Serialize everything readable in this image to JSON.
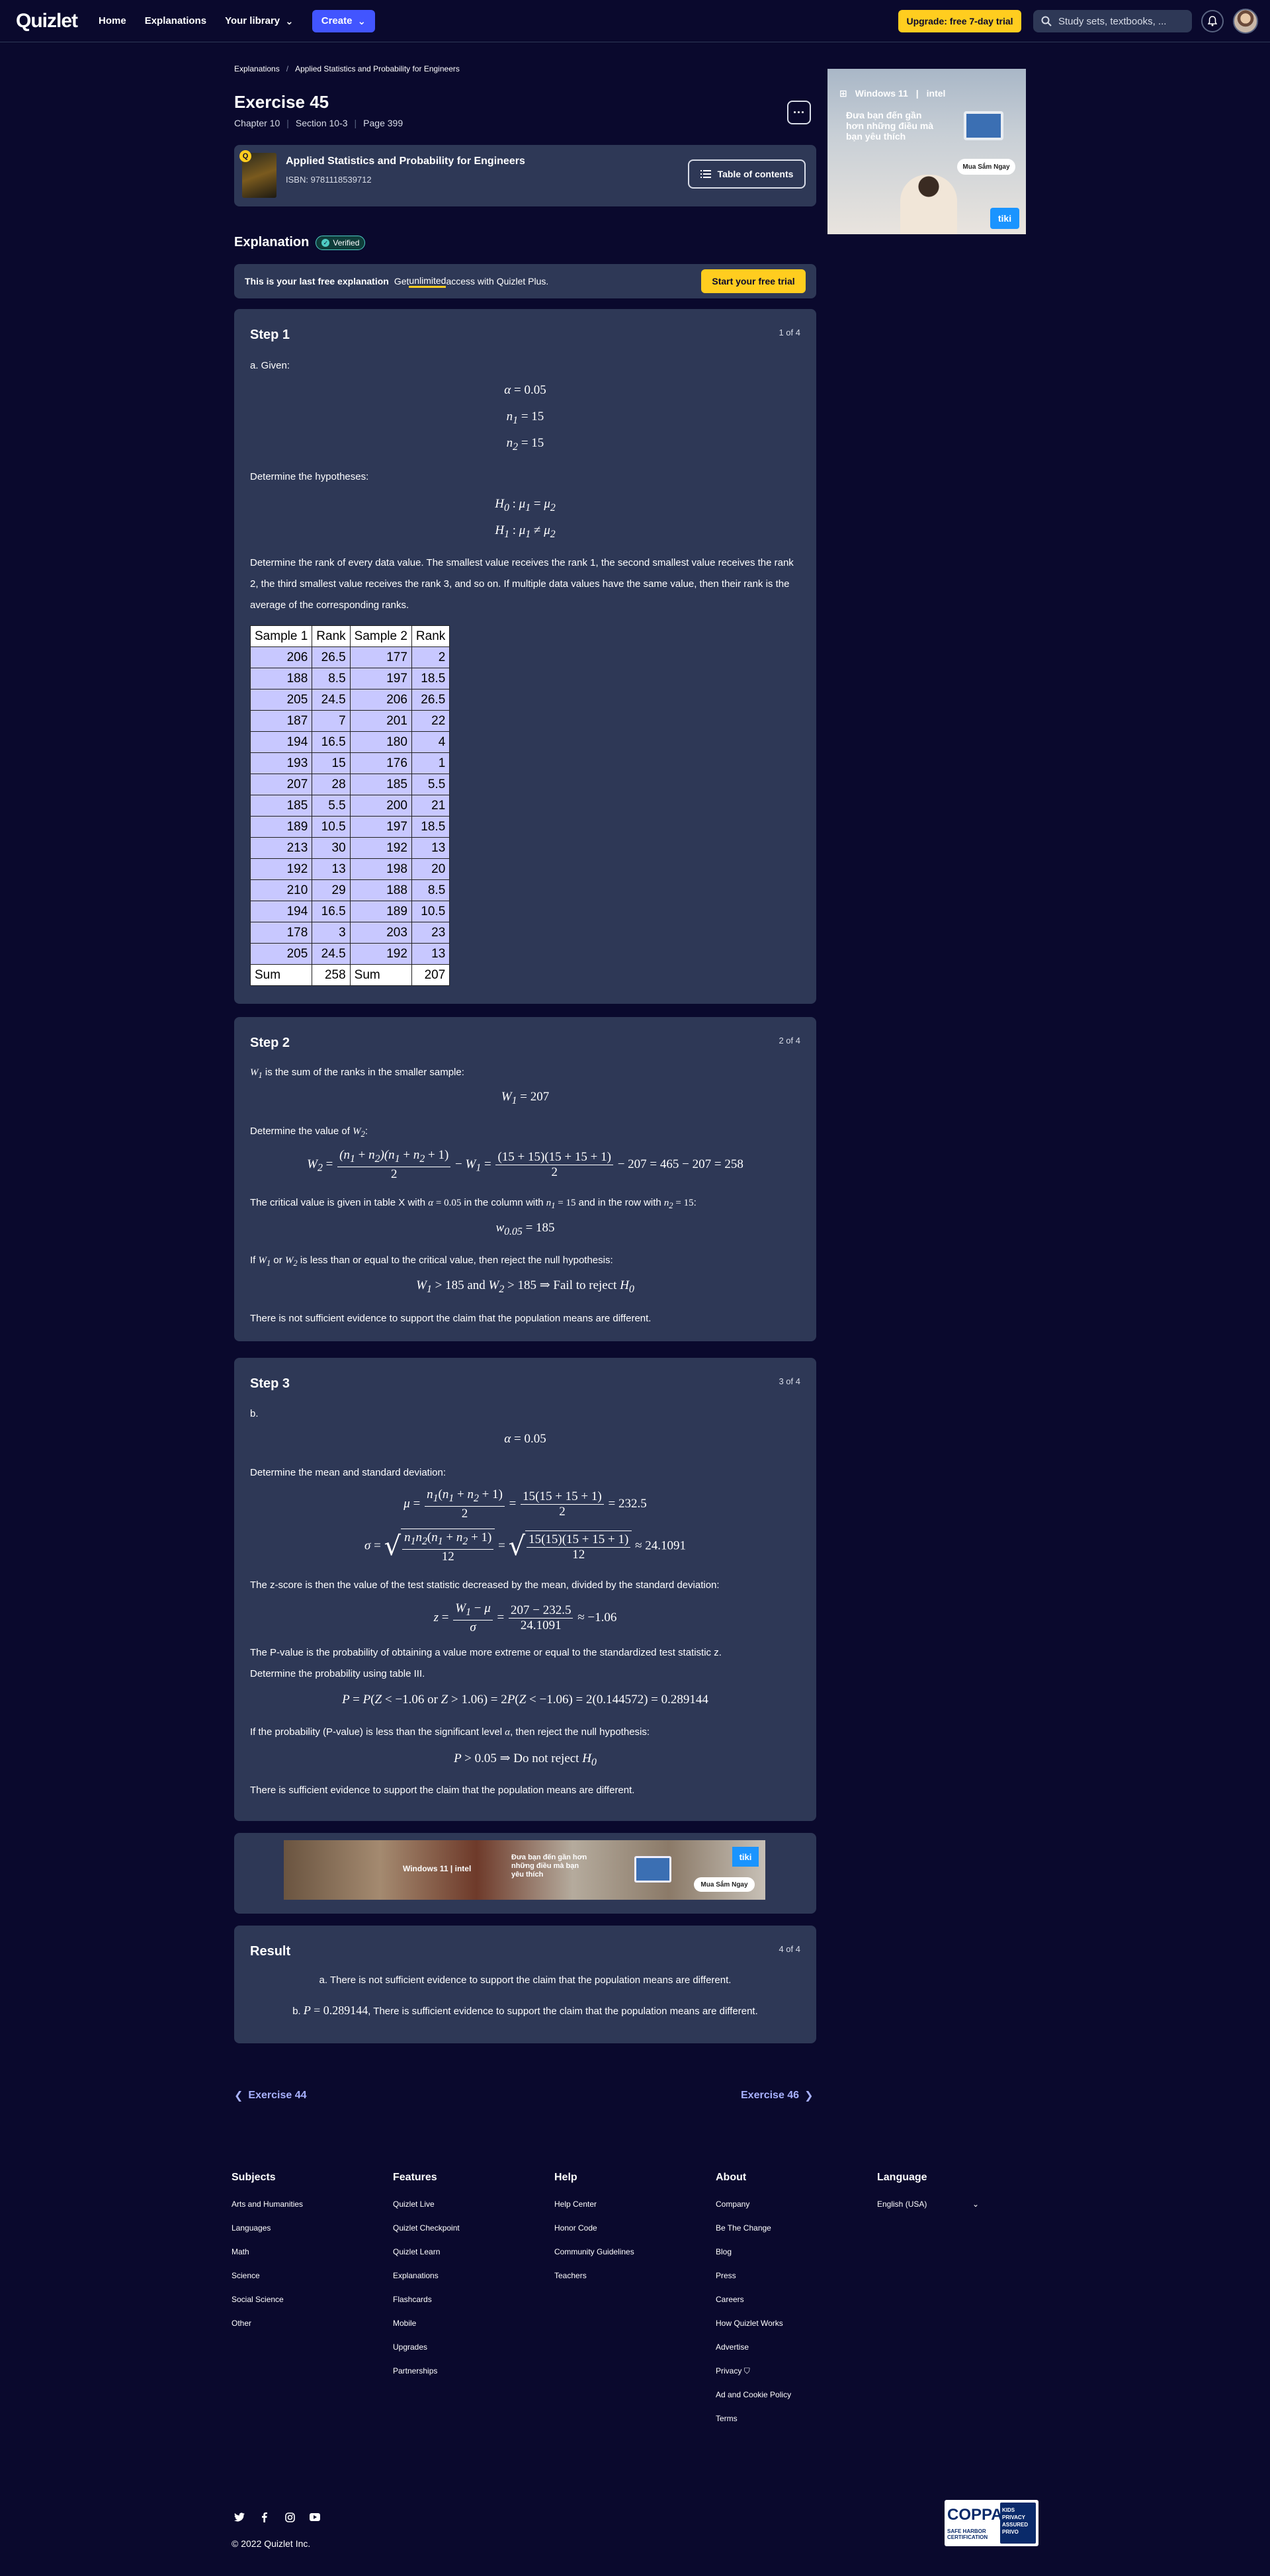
{
  "nav": {
    "logo": "Quizlet",
    "home": "Home",
    "explanations": "Explanations",
    "library": "Your library",
    "create": "Create",
    "upgrade": "Upgrade: free 7-day trial",
    "search_placeholder": "Study sets, textbooks, ..."
  },
  "breadcrumb": {
    "root": "Explanations",
    "current": "Applied Statistics and Probability for Engineers"
  },
  "exercise": {
    "title": "Exercise 45",
    "chapter": "Chapter 10",
    "section": "Section 10-3",
    "page": "Page 399",
    "more": "···"
  },
  "book": {
    "title": "Applied Statistics and Probability for Engineers",
    "isbn": "ISBN: 9781118539712",
    "toc": "Table of contents"
  },
  "ad_side": {
    "brand1": "Windows 11",
    "brand2": "intel",
    "text": "Đưa bạn đến gần hơn những điều mà bạn yêu thích",
    "cta": "Mua Sắm Ngay",
    "shop": "tiki"
  },
  "explanation": {
    "heading": "Explanation",
    "verified": "Verified"
  },
  "promo": {
    "bold": "This is your last free explanation",
    "text1": "Get ",
    "underline": "unlimited",
    "text2": " access with Quizlet Plus.",
    "cta": "Start your free trial"
  },
  "step1": {
    "title": "Step 1",
    "count": "1 of 4",
    "given": "a. Given:",
    "hyp_intro": "Determine the hypotheses:",
    "rank_text": "Determine the rank of every data value. The smallest value receives the rank 1, the second smallest value receives the rank 2, the third smallest value receives the rank 3, and so on. If multiple data values have the same value, then their rank is the average of the corresponding ranks.",
    "table": {
      "headers": [
        "Sample 1",
        "Rank",
        "Sample 2",
        "Rank"
      ],
      "rows": [
        [
          "206",
          "26.5",
          "177",
          "2"
        ],
        [
          "188",
          "8.5",
          "197",
          "18.5"
        ],
        [
          "205",
          "24.5",
          "206",
          "26.5"
        ],
        [
          "187",
          "7",
          "201",
          "22"
        ],
        [
          "194",
          "16.5",
          "180",
          "4"
        ],
        [
          "193",
          "15",
          "176",
          "1"
        ],
        [
          "207",
          "28",
          "185",
          "5.5"
        ],
        [
          "185",
          "5.5",
          "200",
          "21"
        ],
        [
          "189",
          "10.5",
          "197",
          "18.5"
        ],
        [
          "213",
          "30",
          "192",
          "13"
        ],
        [
          "192",
          "13",
          "198",
          "20"
        ],
        [
          "210",
          "29",
          "188",
          "8.5"
        ],
        [
          "194",
          "16.5",
          "189",
          "10.5"
        ],
        [
          "178",
          "3",
          "203",
          "23"
        ],
        [
          "205",
          "24.5",
          "192",
          "13"
        ]
      ],
      "sum": [
        "Sum",
        "258",
        "Sum",
        "207"
      ]
    }
  },
  "step2": {
    "title": "Step 2",
    "count": "2 of 4",
    "t1": " is the sum of the ranks in the smaller sample:",
    "t2": "Determine the value of ",
    "t3a": "The critical value is given in table X with ",
    "t3b": " in the column with ",
    "t3c": " and in the row with ",
    "t4a": "If ",
    "t4b": " or ",
    "t4c": " is less than or equal to the critical value, then reject the null hypothesis:",
    "t5": "There is not sufficient evidence to support the claim that the population means are different."
  },
  "step3": {
    "title": "Step 3",
    "count": "3 of 4",
    "b": "b.",
    "t1": "Determine the mean and standard deviation:",
    "t2": "The z-score is then the value of the test statistic decreased by the mean, divided by the standard deviation:",
    "t3": "The P-value is the probability of obtaining a value more extreme or equal to the standardized test statistic z.",
    "t4": "Determine the probability using table III.",
    "t5a": "If the probability (P-value) is less than the significant level ",
    "t5b": ", then reject the null hypothesis:",
    "t6": "There is sufficient evidence to support the claim that the population means are different."
  },
  "result": {
    "title": "Result",
    "count": "4 of 4",
    "a": "a. There is not sufficient evidence to support the claim that the population means are different.",
    "b_pre": "b. ",
    "b_post": " There is sufficient evidence to support the claim that the population means are different."
  },
  "pager": {
    "prev": "Exercise 44",
    "next": "Exercise 46"
  },
  "footer": {
    "subjects": {
      "h": "Subjects",
      "items": [
        "Arts and Humanities",
        "Languages",
        "Math",
        "Science",
        "Social Science",
        "Other"
      ]
    },
    "features": {
      "h": "Features",
      "items": [
        "Quizlet Live",
        "Quizlet Checkpoint",
        "Quizlet Learn",
        "Explanations",
        "Flashcards",
        "Mobile",
        "Upgrades",
        "Partnerships"
      ]
    },
    "help": {
      "h": "Help",
      "items": [
        "Help Center",
        "Honor Code",
        "Community Guidelines",
        "Teachers"
      ]
    },
    "about": {
      "h": "About",
      "items": [
        "Company",
        "Be The Change",
        "Blog",
        "Press",
        "Careers",
        "How Quizlet Works",
        "Advertise",
        "Privacy",
        "Ad and Cookie Policy",
        "Terms"
      ]
    },
    "language": {
      "h": "Language",
      "value": "English (USA)"
    },
    "copyright": "© 2022 Quizlet Inc.",
    "coppa": {
      "big": "COPPA",
      "sub": "SAFE HARBOR CERTIFICATION",
      "seal": "KIDS PRIVACY ASSURED PRIVO"
    }
  }
}
